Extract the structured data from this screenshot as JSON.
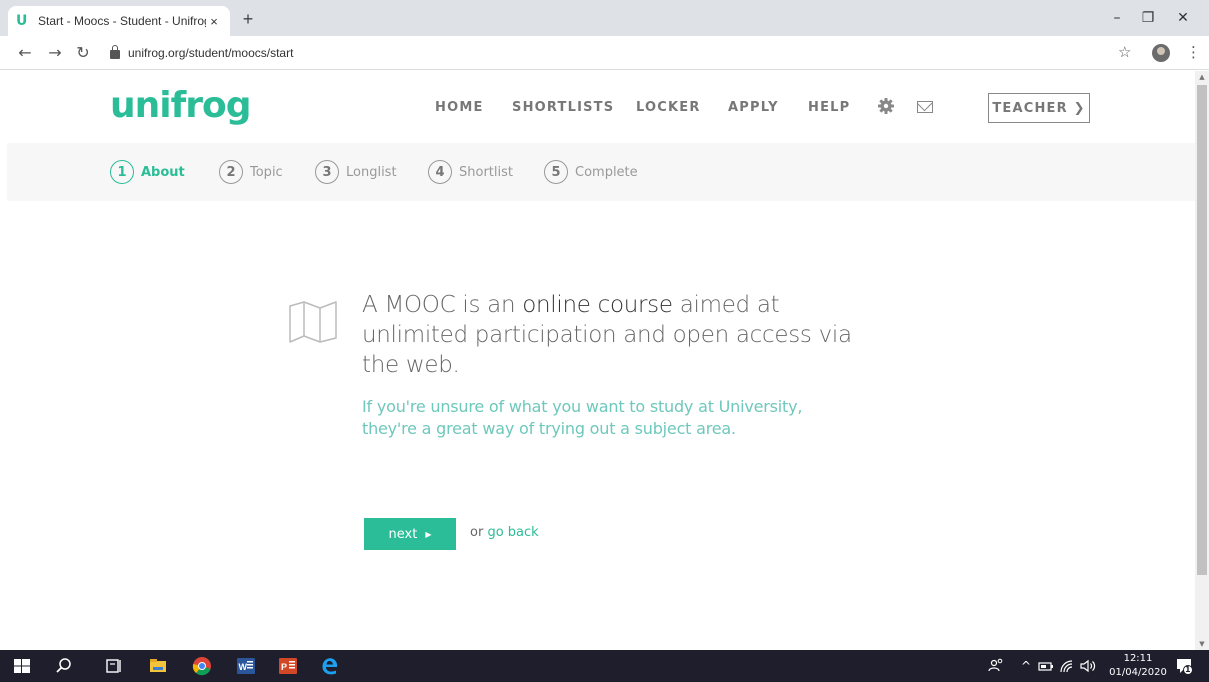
{
  "browser": {
    "tab_title": "Start - Moocs - Student - Unifrog",
    "tab_favicon": "U",
    "tab_close": "×",
    "new_tab": "+",
    "url": "unifrog.org/student/moocs/start"
  },
  "site": {
    "logo": "unifrog",
    "nav": [
      "HOME",
      "SHORTLISTS",
      "LOCKER",
      "APPLY",
      "HELP"
    ],
    "teacher_label": "TEACHER ❯"
  },
  "steps": [
    {
      "num": "1",
      "label": "About",
      "active": true
    },
    {
      "num": "2",
      "label": "Topic",
      "active": false
    },
    {
      "num": "3",
      "label": "Longlist",
      "active": false
    },
    {
      "num": "4",
      "label": "Shortlist",
      "active": false
    },
    {
      "num": "5",
      "label": "Complete",
      "active": false
    }
  ],
  "main": {
    "headline_pre": "A MOOC is an ",
    "headline_em": "online course",
    "headline_post": " aimed at unlimited participation and open access via the web.",
    "subtext": "If you're unsure of what you want to study at University, they're a great way of trying out a subject area.",
    "next_label": "next",
    "or_label": "or ",
    "go_back_label": "go back"
  },
  "taskbar": {
    "time": "12:11",
    "date": "01/04/2020",
    "notification_count": "1"
  },
  "colors": {
    "brand": "#2bbd97",
    "subtext": "#6ec8bc",
    "taskbar": "#1e1e2d"
  }
}
